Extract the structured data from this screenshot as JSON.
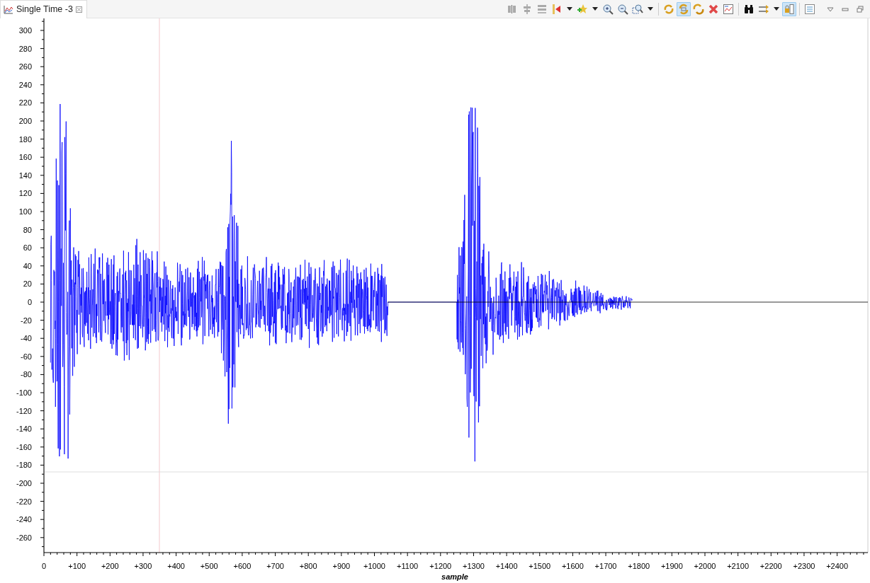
{
  "tab": {
    "title": "Single Time -3",
    "selected": true
  },
  "toolbar": [
    {
      "pressed": false,
      "dropdown": false
    },
    {
      "pressed": false,
      "dropdown": false
    },
    {
      "pressed": false,
      "dropdown": false
    },
    {
      "pressed": false,
      "dropdown": true
    },
    {
      "pressed": false,
      "dropdown": true
    },
    {
      "pressed": false,
      "dropdown": false
    },
    {
      "pressed": false,
      "dropdown": false
    },
    {
      "pressed": false,
      "dropdown": true
    },
    {
      "pressed": false,
      "dropdown": false
    },
    {
      "pressed": true,
      "dropdown": false
    },
    {
      "pressed": false,
      "dropdown": false
    },
    {
      "pressed": false,
      "dropdown": false
    },
    {
      "pressed": false,
      "dropdown": false
    },
    {
      "pressed": false,
      "dropdown": false
    },
    {
      "pressed": false,
      "dropdown": true
    },
    {
      "pressed": true,
      "dropdown": false
    },
    {
      "pressed": false,
      "dropdown": false
    }
  ],
  "chart": {
    "xlabel": "sample",
    "yticks": [
      "300",
      "280",
      "260",
      "240",
      "220",
      "200",
      "180",
      "160",
      "140",
      "120",
      "100",
      "80",
      "60",
      "40",
      "20",
      "0",
      "-20",
      "-40",
      "-60",
      "-80",
      "-100",
      "-120",
      "-140",
      "-160",
      "-180",
      "-200",
      "-220",
      "-240",
      "-260"
    ],
    "xticks": [
      "0",
      "+100",
      "+200",
      "+300",
      "+400",
      "+500",
      "+600",
      "+700",
      "+800",
      "+900",
      "+1000",
      "+1100",
      "+1200",
      "+1300",
      "+1400",
      "+1500",
      "+1600",
      "+1700",
      "+1800",
      "+1900",
      "+2000",
      "+2100",
      "+2200",
      "+2300",
      "+2400"
    ]
  }
}
